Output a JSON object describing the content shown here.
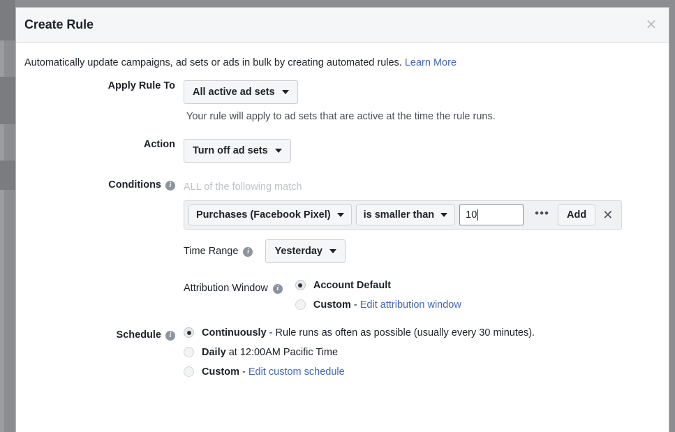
{
  "dialog": {
    "title": "Create Rule",
    "close_icon": "close-icon",
    "intro": {
      "text": "Automatically update campaigns, ad sets or ads in bulk by creating automated rules.",
      "link_label": "Learn More"
    }
  },
  "apply_rule_to": {
    "label": "Apply Rule To",
    "value": "All active ad sets",
    "help_text": "Your rule will apply to ad sets that are active at the time the rule runs."
  },
  "action": {
    "label": "Action",
    "value": "Turn off ad sets"
  },
  "conditions": {
    "label": "Conditions",
    "info_icon": "info-icon",
    "match_mode": "ALL of the following match",
    "rows": [
      {
        "metric": "Purchases (Facebook Pixel)",
        "operator": "is smaller than",
        "value": "10",
        "more_label": "•••",
        "add_label": "Add",
        "remove_label": "✕"
      }
    ]
  },
  "time_range": {
    "label": "Time Range",
    "info_icon": "info-icon",
    "value": "Yesterday"
  },
  "attribution_window": {
    "label": "Attribution Window",
    "info_icon": "info-icon",
    "options": [
      {
        "strong": "Account Default",
        "rest": "",
        "link": "",
        "selected": true
      },
      {
        "strong": "Custom",
        "rest": " - ",
        "link": "Edit attribution window",
        "selected": false
      }
    ]
  },
  "schedule": {
    "label": "Schedule",
    "info_icon": "info-icon",
    "options": [
      {
        "strong": "Continuously",
        "rest": " - Rule runs as often as possible (usually every 30 minutes).",
        "link": "",
        "selected": true
      },
      {
        "strong": "Daily",
        "rest": " at 12:00AM Pacific Time",
        "link": "",
        "selected": false
      },
      {
        "strong": "Custom",
        "rest": " - ",
        "link": "Edit custom schedule",
        "selected": false
      }
    ]
  },
  "colors": {
    "link": "#4267b2",
    "text": "#1d2129",
    "muted": "#4b4f56",
    "placeholder": "#bec2c9",
    "chrome": "#f5f6f7"
  }
}
